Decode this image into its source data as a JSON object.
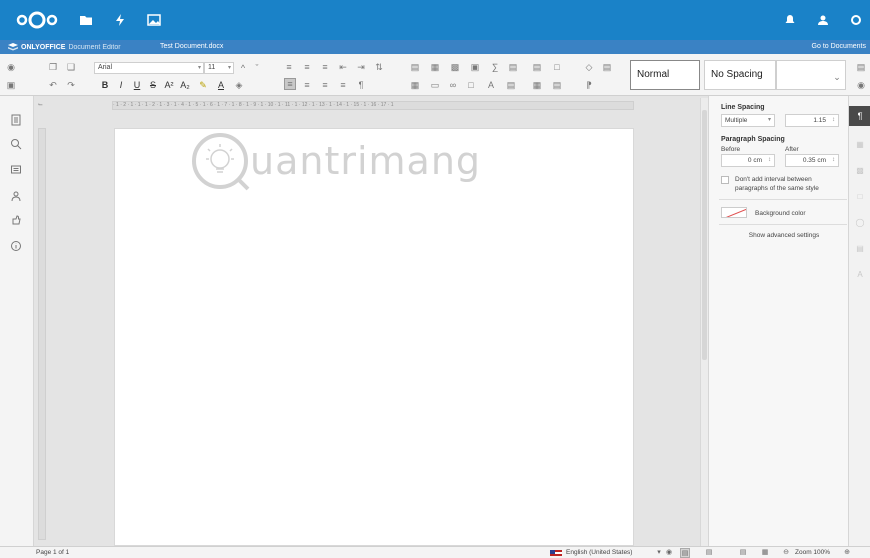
{
  "nextcloud": {
    "apps": [
      "files-icon",
      "activity-icon",
      "gallery-icon"
    ],
    "right_icons": [
      "notifications-icon",
      "contacts-icon",
      "settings-icon"
    ]
  },
  "tabbar": {
    "brand_name": "ONLYOFFICE",
    "brand_sub": "Document Editor",
    "document_title": "Test Document.docx",
    "go_to_documents": "Go to Documents"
  },
  "toolbar": {
    "font_name": "Arial",
    "font_size": "11",
    "styles": {
      "normal": "Normal",
      "no_spacing": "No Spacing"
    }
  },
  "ruler": {
    "marks": "· 1 · 2 · 1 · 1 · 1 · 2 · 1 · 3 · 1 · 4 · 1 · 5 · 1 · 6 · 1 · 7 · 1 · 8 · 1 · 9 · 1 · 10 · 1 · 11 · 1 · 12 · 1 · 13 · 1 · 14 · 1 · 15 · 1 · 16 · 17 · 1"
  },
  "watermark": {
    "text": "uantrimang"
  },
  "paragraph_panel": {
    "line_spacing_title": "Line Spacing",
    "line_spacing_type": "Multiple",
    "line_spacing_value": "1.15",
    "paragraph_spacing_title": "Paragraph Spacing",
    "before_label": "Before",
    "after_label": "After",
    "before_value": "0 cm",
    "after_value": "0.35 cm",
    "dont_add_interval_line1": "Don't add interval between",
    "dont_add_interval_line2": "paragraphs of the same style",
    "background_color_label": "Background color",
    "show_advanced": "Show advanced settings"
  },
  "status": {
    "page_info": "Page 1 of 1",
    "language": "English (United States)",
    "zoom": "Zoom 100%"
  },
  "colors": {
    "nextcloud_blue": "#1a82c8",
    "editor_tab_blue": "#3a82c4"
  }
}
